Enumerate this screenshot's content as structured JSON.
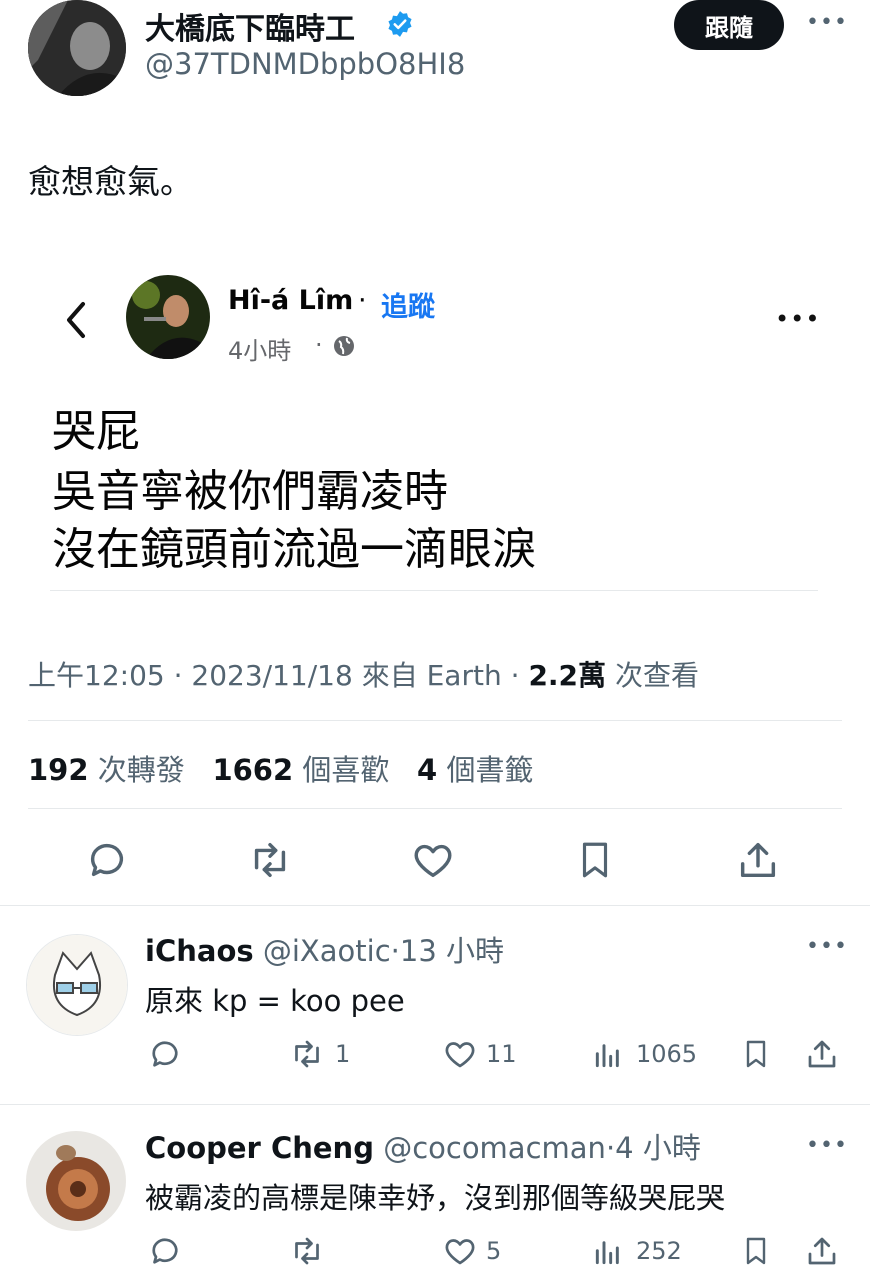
{
  "author": {
    "name": "大橋底下臨時工",
    "handle": "@37TDNMDbpbO8HI8",
    "verified": true,
    "follow_label": "跟隨"
  },
  "tweet_text": "愈想愈氣。",
  "embedded_post": {
    "name": "Hî-á Lîm",
    "separator": "·",
    "follow_label": "追蹤",
    "time": "4小時",
    "time_dot": "·",
    "lines": [
      "哭屁",
      "吳音寧被你們霸凌時",
      "沒在鏡頭前流過一滴眼淚"
    ]
  },
  "meta": {
    "time": "上午12:05",
    "sep1": "·",
    "date": "2023/11/18",
    "source": "來自 Earth",
    "sep2": "·",
    "views_num": "2.2萬",
    "views_label": "次查看"
  },
  "stats": {
    "retweets_num": "192",
    "retweets_label": "次轉發",
    "likes_num": "1662",
    "likes_label": "個喜歡",
    "bookmarks_num": "4",
    "bookmarks_label": "個書籤"
  },
  "replies": [
    {
      "name": "iChaos",
      "handle": "@iXaotic",
      "time": "·13 小時",
      "text": "原來 kp = koo pee",
      "retweets": "1",
      "likes": "11",
      "views": "1065"
    },
    {
      "name": "Cooper Cheng",
      "handle": "@cocomacman",
      "time": "·4 小時",
      "text": "被霸凌的高標是陳幸妤，沒到那個等級哭屁哭",
      "retweets": "",
      "likes": "5",
      "views": "252"
    }
  ],
  "colors": {
    "text": "#0f1419",
    "muted": "#536471",
    "accent": "#1d9bf0",
    "fb_blue": "#1877f2"
  }
}
